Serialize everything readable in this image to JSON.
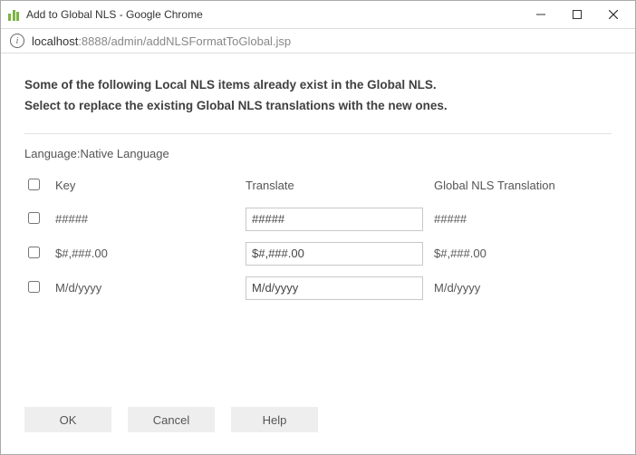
{
  "window": {
    "title": "Add to Global NLS - Google Chrome"
  },
  "address": {
    "host": "localhost",
    "rest": ":8888/admin/addNLSFormatToGlobal.jsp"
  },
  "intro": {
    "line1": "Some of the following Local NLS items already exist in the Global NLS.",
    "line2": "Select to replace the existing Global NLS translations with the new ones."
  },
  "language_label": "Language:Native Language",
  "headers": {
    "key": "Key",
    "translate": "Translate",
    "global": "Global NLS Translation"
  },
  "rows": [
    {
      "key": "#####",
      "translate": "#####",
      "global": "#####"
    },
    {
      "key": "$#,###.00",
      "translate": "$#,###.00",
      "global": "$#,###.00"
    },
    {
      "key": "M/d/yyyy",
      "translate": "M/d/yyyy",
      "global": "M/d/yyyy"
    }
  ],
  "buttons": {
    "ok": "OK",
    "cancel": "Cancel",
    "help": "Help"
  }
}
